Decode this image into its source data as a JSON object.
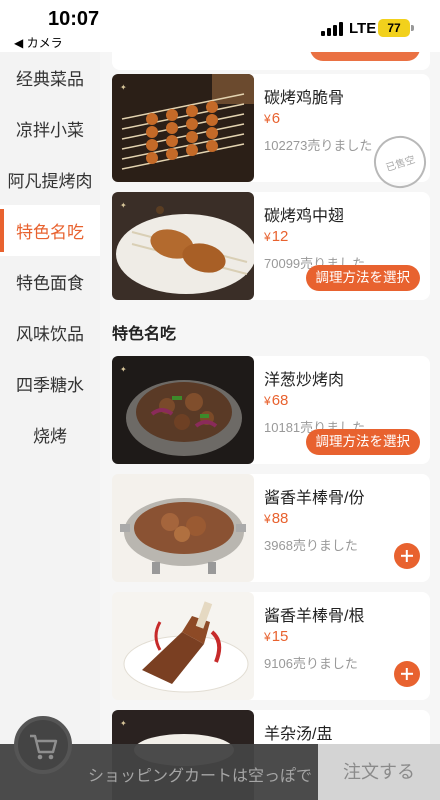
{
  "status_bar": {
    "time": "10:07",
    "back_label": "◀ カメラ",
    "network": "LTE",
    "battery": "77"
  },
  "sidebar": {
    "items": [
      {
        "label": "经典菜品",
        "active": false
      },
      {
        "label": "凉拌小菜",
        "active": false
      },
      {
        "label": "阿凡提烤肉",
        "active": false
      },
      {
        "label": "特色名吃",
        "active": true
      },
      {
        "label": "特色面食",
        "active": false
      },
      {
        "label": "风味饮品",
        "active": false
      },
      {
        "label": "四季糖水",
        "active": false
      },
      {
        "label": "烧烤",
        "active": false
      }
    ]
  },
  "section_title": "特色名吃",
  "products": [
    {
      "name": "碳烤鸡脆骨",
      "price": "6",
      "sold": "102273売りました",
      "stamp": "已售空",
      "action": "none",
      "icon": "chicken-cartilage-skewers-image"
    },
    {
      "name": "碳烤鸡中翅",
      "price": "12",
      "sold": "70099売りました",
      "action_label": "調理方法を選択",
      "icon": "grilled-chicken-wings-image"
    },
    {
      "name": "洋葱炒烤肉",
      "price": "68",
      "sold": "10181売りました",
      "action_label": "調理方法を選択",
      "icon": "onion-stir-fried-meat-image"
    },
    {
      "name": "酱香羊棒骨/份",
      "price": "88",
      "sold": "3968売りました",
      "action": "add",
      "icon": "lamb-bone-pot-image"
    },
    {
      "name": "酱香羊棒骨/根",
      "price": "15",
      "sold": "9106売りました",
      "action": "add",
      "icon": "single-lamb-bone-image"
    },
    {
      "name": "羊杂汤/盅",
      "price": "",
      "sold": "",
      "action": "none",
      "icon": "lamb-offal-soup-image"
    }
  ],
  "currency": "¥",
  "cart": {
    "empty_text": "ショッピングカートは空っぽで",
    "order_label": "注文する"
  },
  "colors": {
    "accent": "#e8622f",
    "sidebar_bg": "#f3f3f3",
    "cart_bar": "#444444"
  }
}
